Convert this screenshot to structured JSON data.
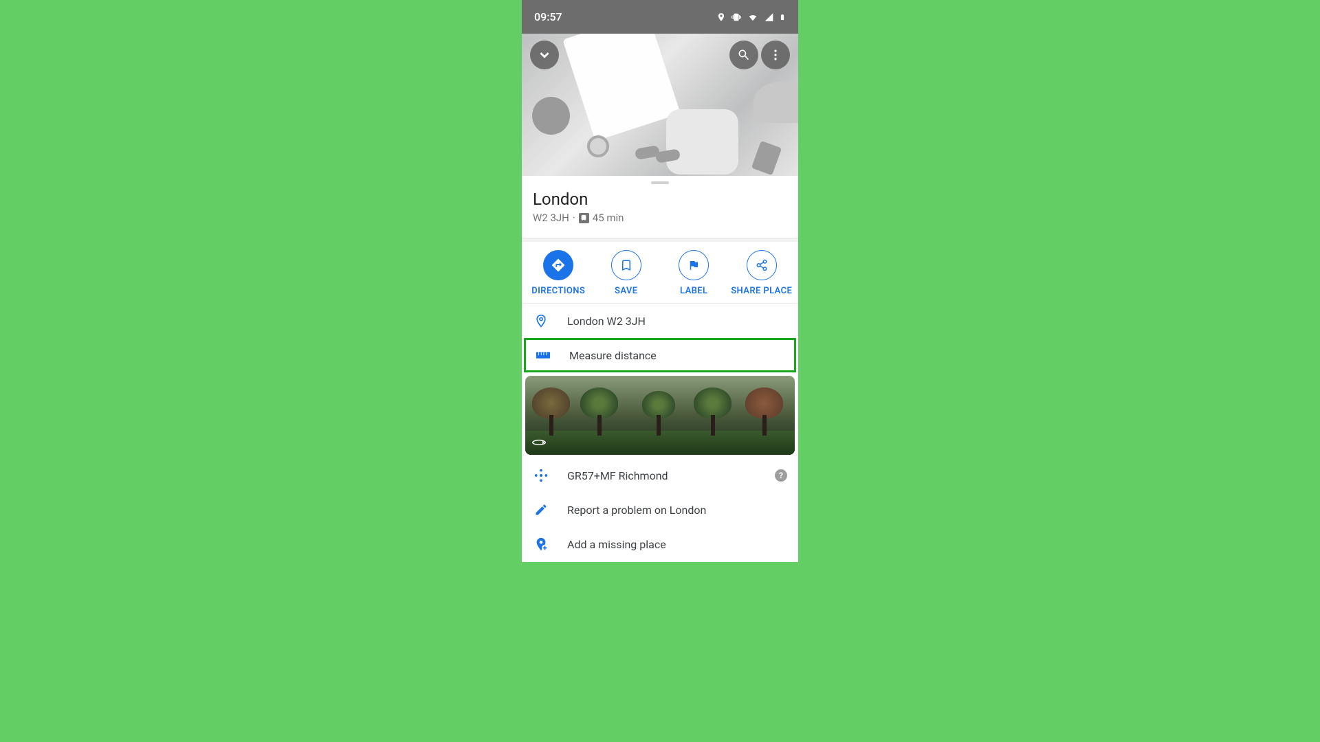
{
  "status": {
    "time": "09:57"
  },
  "header": {
    "back_icon": "chevron-down",
    "search_icon": "search",
    "more_icon": "more-vert"
  },
  "place": {
    "title": "London",
    "postcode": "W2 3JH",
    "separator": "·",
    "time": "45 min"
  },
  "actions": {
    "directions": "DIRECTIONS",
    "save": "SAVE",
    "label": "LABEL",
    "share": "SHARE PLACE"
  },
  "rows": {
    "address": "London W2 3JH",
    "measure": "Measure distance",
    "plus_code": "GR57+MF Richmond",
    "report": "Report a problem on London",
    "add_place": "Add a missing place"
  }
}
